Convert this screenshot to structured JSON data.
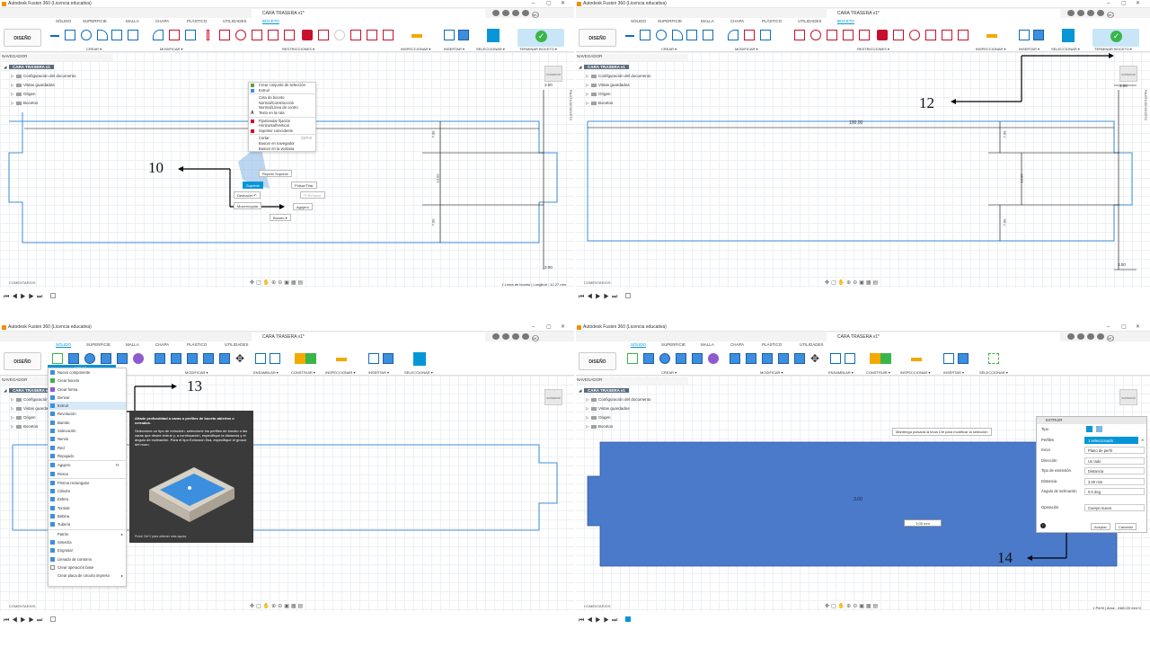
{
  "window_title": "Autodesk Fusion 360 (Licencia educativa)",
  "doc_tab": "CARA TRASERA v1*",
  "avatar": "MC",
  "design_button": "DISEÑO",
  "ribbon_tabs": [
    "SÓLIDO",
    "SUPERFICIE",
    "MALLA",
    "CHAPA",
    "PLÁSTICO",
    "UTILIDADES",
    "BOCETO"
  ],
  "ribbon_tabs_solid": [
    "SÓLIDO",
    "SUPERFICIE",
    "MALLA",
    "CHAPA",
    "PLÁSTICO",
    "UTILIDADES"
  ],
  "sketch_groups": {
    "crear": "CREAR ▾",
    "modificar": "MODIFICAR ▾",
    "restricciones": "RESTRICCIONES ▾",
    "inspeccionar": "INSPECCIONAR ▾",
    "insertar": "INSERTAR ▾",
    "seleccionar": "SELECCIONAR ▾",
    "terminar": "TERMINAR BOCETO ▾"
  },
  "solid_groups": {
    "crear": "CREAR ▾",
    "modificar": "MODIFICAR ▾",
    "ensamblar": "ENSAMBLAR ▾",
    "construir": "CONSTRUIR ▾",
    "inspeccionar": "INSPECCIONAR ▾",
    "insertar": "INSERTAR ▾",
    "seleccionar": "SELECCIONAR ▾"
  },
  "navigator": {
    "header": "NAVEGADOR",
    "component": "CARA TRASERA v1",
    "items": [
      "Configuración del documento",
      "Vistas guardadas",
      "Origen",
      "Bocetos"
    ]
  },
  "viewcube_label": "SUPERIOR",
  "paleta": "PALETA DE BOCETO",
  "comments": "COMENTARIOS",
  "status": {
    "p1": "1 Línea de boceto | Longitud : 12.27 mm",
    "p4": "1 Perfil | Área : 2460.00 mm^2"
  },
  "dims": {
    "top": "100.00",
    "d7a": "7.00",
    "d10": "10.00",
    "d7b": "7.00",
    "d3a": "3.00",
    "d3b": "3.00"
  },
  "annotations": {
    "a10": "10",
    "a12": "12",
    "a13": "13",
    "a14": "14"
  },
  "context_menu": [
    "Crear conjunto de selección",
    "Extruir",
    "Cota de boceto",
    "Normal/Construcción",
    "Normal/Línea de centro",
    "Texto en la ruta",
    "Fijar/anular fijación",
    "Horizontal/Vertical",
    "Suprimir coincidente",
    "Cortar",
    "Buscar en navegador",
    "Buscar en la ventana"
  ],
  "context_shortcut": "Ctrl+X",
  "marking_menu": {
    "repeat": "Repetir Suprimir",
    "delete": "Suprimir",
    "undo": "Deshacer",
    "push_pull": "Pulsar/Tirar",
    "redo": "Rehacer",
    "hole": "Agujero",
    "move_copy": "Mover/copiar",
    "sketch": "Boceto"
  },
  "create_menu": {
    "header": "CREAR ▾",
    "items": [
      "Nuevo componente",
      "Crear boceto",
      "Crear forma",
      "Derivar",
      "Extruir",
      "Revolución",
      "Barrido",
      "Solevación",
      "Nervio",
      "Red",
      "Repujado",
      "Agujero",
      "Rosca",
      "Prisma rectangular",
      "Cilindro",
      "Esfera",
      "Toroide",
      "Bobina",
      "Tubería",
      "Patrón",
      "Simetría",
      "Engrosar",
      "Llenado de contorno",
      "Crear operación base",
      "Crear placa de circuito impreso"
    ],
    "hole_shortcut": "H"
  },
  "tooltip": {
    "p1": "Añade profundidad a caras o perfiles de boceto abiertos o cerrados.",
    "p2": "Seleccione un tipo de extrusión, seleccione los perfiles de boceto o las caras que desee extruir y, a continuación, especifique la distancia y el ángulo de inclinación. Para el tipo Extrusión fina, especifique el grosor del muro.",
    "foot": "Pulse Ctrl+/ para obtener más ayuda."
  },
  "extrude_dialog": {
    "title": "EXTRUIR",
    "rows": [
      {
        "label": "Tipo",
        "value": ""
      },
      {
        "label": "Perfiles",
        "value": "1 seleccionado"
      },
      {
        "label": "Inicio",
        "value": "Plano de perfil"
      },
      {
        "label": "Dirección",
        "value": "Un lado"
      },
      {
        "label": "Tipo de extensión",
        "value": "Distancia"
      },
      {
        "label": "Distancia",
        "value": "3.00 mm"
      },
      {
        "label": "Ángulo de inclinación",
        "value": "0.0 deg"
      },
      {
        "label": "Operación",
        "value": "Cuerpo nuevo"
      }
    ],
    "ok": "Aceptar",
    "cancel": "Cancelar"
  },
  "hint": "Mantenga pulsada la tecla Ctrl para modificar la selección",
  "dist_box": "3.00 mm",
  "body_label": "3.00",
  "colors": {
    "accent": "#0696d7",
    "finish": "#3ab54a",
    "body": "#4a7ac9"
  }
}
